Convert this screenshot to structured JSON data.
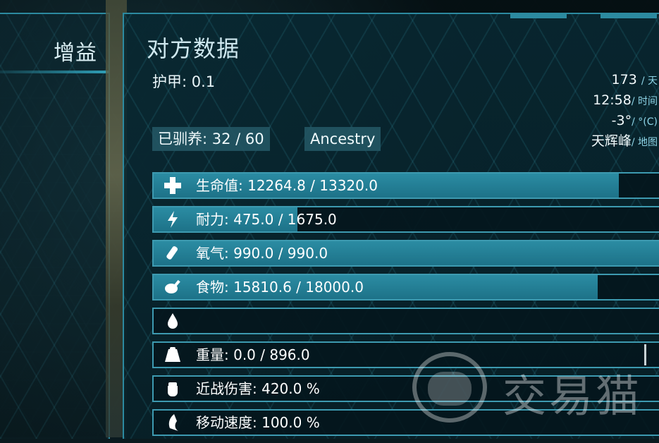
{
  "left_panel": {
    "title": "增益"
  },
  "main_panel": {
    "title": "对方数据",
    "armor": "护甲: 0.1",
    "tamed": "已驯养: 32 / 60",
    "ancestry": "Ancestry",
    "info": {
      "day": "173",
      "day_unit": "/ 天",
      "time": "12:58",
      "time_unit": "/ 时间",
      "temp": "-3°",
      "temp_unit": "/ °(C)",
      "location": "天辉峰",
      "location_unit": "/ 地图"
    }
  },
  "stats": [
    {
      "icon": "health-cross-icon",
      "label": "生命值: 12264.8 / 13320.0",
      "fill": 0.921
    },
    {
      "icon": "stamina-bolt-icon",
      "label": "耐力: 475.0 / 1675.0",
      "fill": 0.284
    },
    {
      "icon": "oxygen-tank-icon",
      "label": "氧气: 990.0 / 990.0",
      "fill": 1.0
    },
    {
      "icon": "food-drumstick-icon",
      "label": "食物: 15810.6 / 18000.0",
      "fill": 0.878
    },
    {
      "icon": "water-drop-icon",
      "label": "",
      "fill": 0.0
    },
    {
      "icon": "weight-icon",
      "label": "重量: 0.0 / 896.0",
      "fill": 0.0
    },
    {
      "icon": "melee-fist-icon",
      "label": "近战伤害: 420.0 %",
      "fill": 0.0
    },
    {
      "icon": "movement-boot-icon",
      "label": "移动速度: 100.0 %",
      "fill": 0.0
    }
  ],
  "watermark": {
    "text": "交易猫"
  }
}
